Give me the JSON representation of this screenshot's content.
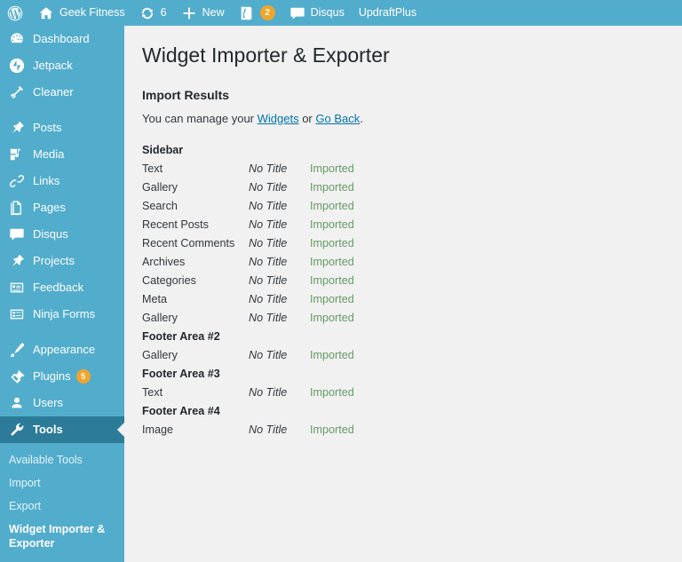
{
  "adminbar": {
    "items": [
      {
        "name": "wp-logo",
        "icon": "wordpress-icon",
        "label": "",
        "badge": null
      },
      {
        "name": "site-name",
        "icon": "home-icon",
        "label": "Geek Fitness",
        "badge": null
      },
      {
        "name": "updates",
        "icon": "update-icon",
        "label": "6",
        "badge": null
      },
      {
        "name": "new-content",
        "icon": "plus-icon",
        "label": "New",
        "badge": null
      },
      {
        "name": "yoast-seo",
        "icon": "yoast-icon",
        "label": "",
        "badge": "2"
      },
      {
        "name": "disqus",
        "icon": "comment-icon",
        "label": "Disqus",
        "badge": null
      },
      {
        "name": "updraftplus",
        "icon": "none",
        "label": "UpdraftPlus",
        "badge": null
      }
    ]
  },
  "sidebar": {
    "items": [
      {
        "label": "Dashboard",
        "icon": "dashboard-icon",
        "badge": null,
        "separator_after": false,
        "current": false
      },
      {
        "label": "Jetpack",
        "icon": "jetpack-icon",
        "badge": null,
        "separator_after": false,
        "current": false
      },
      {
        "label": "Cleaner",
        "icon": "cleaner-icon",
        "badge": null,
        "separator_after": true,
        "current": false
      },
      {
        "label": "Posts",
        "icon": "pin-icon",
        "badge": null,
        "separator_after": false,
        "current": false
      },
      {
        "label": "Media",
        "icon": "media-icon",
        "badge": null,
        "separator_after": false,
        "current": false
      },
      {
        "label": "Links",
        "icon": "link-icon",
        "badge": null,
        "separator_after": false,
        "current": false
      },
      {
        "label": "Pages",
        "icon": "pages-icon",
        "badge": null,
        "separator_after": false,
        "current": false
      },
      {
        "label": "Disqus",
        "icon": "comment-icon",
        "badge": null,
        "separator_after": false,
        "current": false
      },
      {
        "label": "Projects",
        "icon": "pin-icon",
        "badge": null,
        "separator_after": false,
        "current": false
      },
      {
        "label": "Feedback",
        "icon": "feedback-icon",
        "badge": null,
        "separator_after": false,
        "current": false
      },
      {
        "label": "Ninja Forms",
        "icon": "forms-icon",
        "badge": null,
        "separator_after": true,
        "current": false
      },
      {
        "label": "Appearance",
        "icon": "brush-icon",
        "badge": null,
        "separator_after": false,
        "current": false
      },
      {
        "label": "Plugins",
        "icon": "plugins-icon",
        "badge": "5",
        "separator_after": false,
        "current": false
      },
      {
        "label": "Users",
        "icon": "user-icon",
        "badge": null,
        "separator_after": false,
        "current": false
      },
      {
        "label": "Tools",
        "icon": "wrench-icon",
        "badge": null,
        "separator_after": false,
        "current": true
      }
    ],
    "submenu": [
      {
        "label": "Available Tools",
        "current": false
      },
      {
        "label": "Import",
        "current": false
      },
      {
        "label": "Export",
        "current": false
      },
      {
        "label": "Widget Importer & Exporter",
        "current": true
      }
    ]
  },
  "main": {
    "page_title": "Widget Importer & Exporter",
    "section_title": "Import Results",
    "manage_prefix": "You can manage your ",
    "manage_link_widgets": "Widgets",
    "manage_middle": " or ",
    "manage_link_goback": "Go Back",
    "manage_suffix": ".",
    "groups": [
      {
        "name": "Sidebar",
        "widgets": [
          {
            "name": "Text",
            "title": "No Title",
            "status": "Imported"
          },
          {
            "name": "Gallery",
            "title": "No Title",
            "status": "Imported"
          },
          {
            "name": "Search",
            "title": "No Title",
            "status": "Imported"
          },
          {
            "name": "Recent Posts",
            "title": "No Title",
            "status": "Imported"
          },
          {
            "name": "Recent Comments",
            "title": "No Title",
            "status": "Imported"
          },
          {
            "name": "Archives",
            "title": "No Title",
            "status": "Imported"
          },
          {
            "name": "Categories",
            "title": "No Title",
            "status": "Imported"
          },
          {
            "name": "Meta",
            "title": "No Title",
            "status": "Imported"
          },
          {
            "name": "Gallery",
            "title": "No Title",
            "status": "Imported"
          }
        ]
      },
      {
        "name": "Footer Area #2",
        "widgets": [
          {
            "name": "Gallery",
            "title": "No Title",
            "status": "Imported"
          }
        ]
      },
      {
        "name": "Footer Area #3",
        "widgets": [
          {
            "name": "Text",
            "title": "No Title",
            "status": "Imported"
          }
        ]
      },
      {
        "name": "Footer Area #4",
        "widgets": [
          {
            "name": "Image",
            "title": "No Title",
            "status": "Imported"
          }
        ]
      }
    ]
  },
  "colors": {
    "admin_bar": "#52accc",
    "sidebar": "#52accc",
    "sidebar_current": "#2c7c99",
    "badge": "#f0a42a",
    "link": "#0073aa",
    "status_imported": "#669966",
    "content_bg": "#f1f1f1"
  }
}
